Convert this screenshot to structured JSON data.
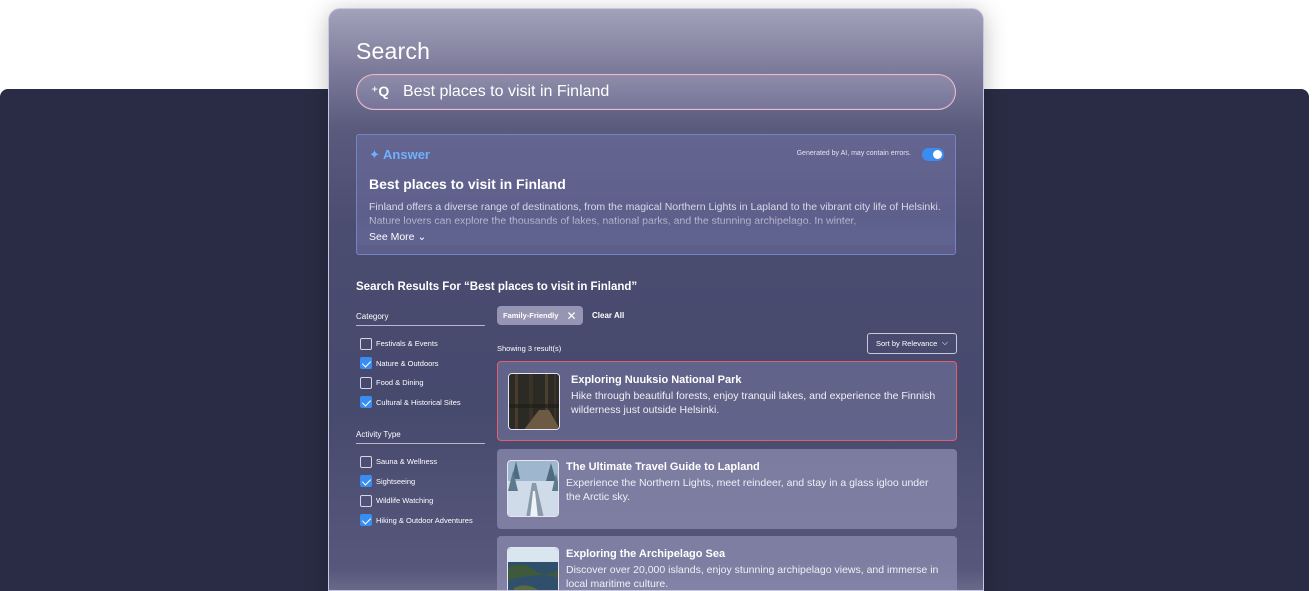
{
  "page": {
    "title": "Search"
  },
  "search": {
    "icon": "ai-search-icon",
    "value": "Best places to visit in Finland"
  },
  "answer": {
    "label": "Answer",
    "note": "Generated by AI, may contain errors.",
    "toggle_on": true,
    "title": "Best places to visit in Finland",
    "body": "Finland offers a diverse range of destinations, from the magical Northern Lights in Lapland to the vibrant city life of Helsinki. Nature lovers can explore the thousands of lakes, national parks, and the stunning archipelago. In winter,",
    "see_more": "See More"
  },
  "results": {
    "heading": "Search Results For “Best places to visit in Finland”",
    "showing": "Showing 3 result(s)",
    "sort_label": "Sort by Relevance",
    "active_chip": "Family-Friendly",
    "clear_all": "Clear All",
    "items": [
      {
        "title": "Exploring Nuuksio National Park",
        "description": "Hike through beautiful forests, enjoy tranquil lakes, and experience the Finnish wilderness just outside Helsinki.",
        "selected": true
      },
      {
        "title": "The Ultimate Travel Guide to Lapland",
        "description": "Experience the Northern Lights, meet reindeer, and stay in a glass igloo under the Arctic sky.",
        "selected": false
      },
      {
        "title": "Exploring the Archipelago Sea",
        "description": "Discover over 20,000 islands, enjoy stunning archipelago views, and immerse in local maritime culture.",
        "selected": false
      }
    ]
  },
  "filters": {
    "category": {
      "heading": "Category",
      "options": [
        {
          "label": "Festivals & Events",
          "checked": false
        },
        {
          "label": "Nature & Outdoors",
          "checked": true
        },
        {
          "label": "Food & Dining",
          "checked": false
        },
        {
          "label": "Cultural & Historical Sites",
          "checked": true
        }
      ]
    },
    "activity": {
      "heading": "Activity Type",
      "options": [
        {
          "label": "Sauna & Wellness",
          "checked": false
        },
        {
          "label": "Sightseeing",
          "checked": true
        },
        {
          "label": "Wildlife Watching",
          "checked": false
        },
        {
          "label": "Hiking & Outdoor Adventures",
          "checked": true
        }
      ]
    }
  },
  "colors": {
    "accent": "#3b8cf0",
    "answer_label": "#6fb0ff",
    "selected_border": "#e0606e",
    "backdrop": "#2a2c45"
  }
}
